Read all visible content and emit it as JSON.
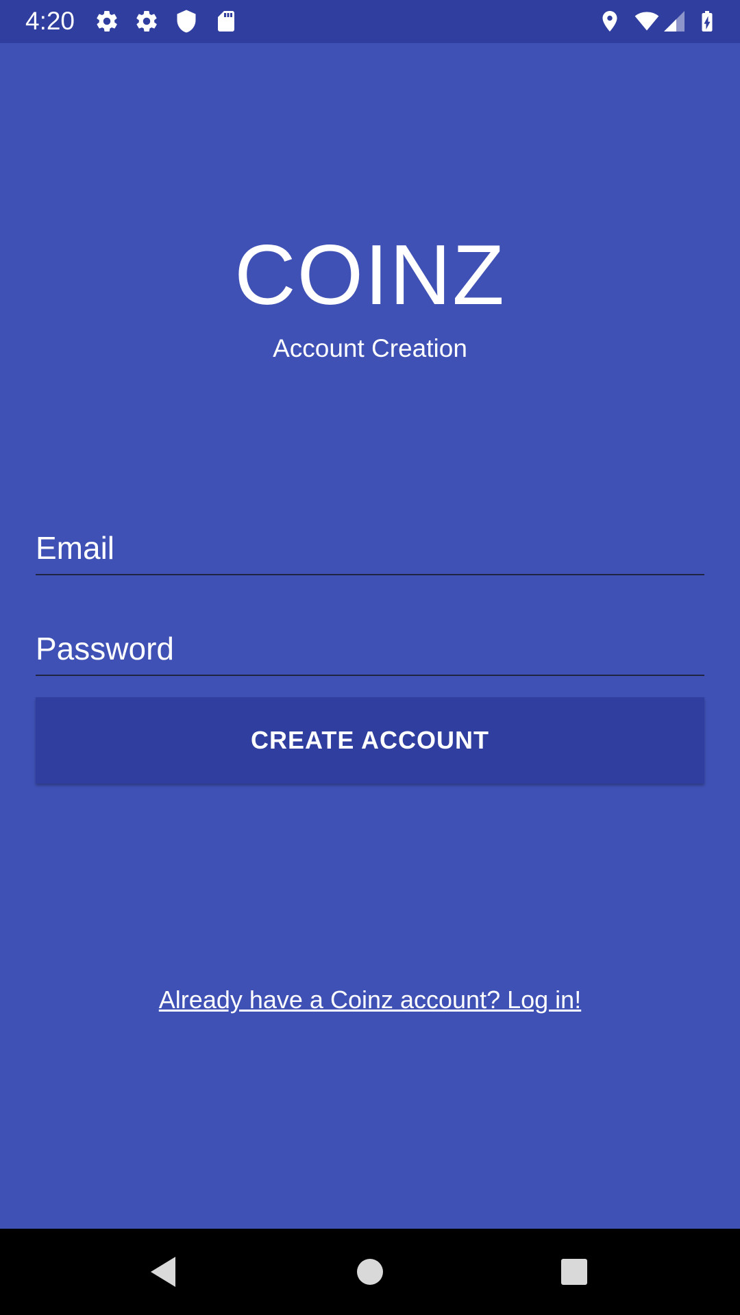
{
  "status_bar": {
    "time": "4:20",
    "left_icons": [
      "settings-icon",
      "settings-icon",
      "shield-icon",
      "sd-card-icon"
    ],
    "right_icons": [
      "location-icon",
      "wifi-icon",
      "signal-icon",
      "battery-charging-icon"
    ]
  },
  "header": {
    "app_title": "COINZ",
    "subtitle": "Account Creation"
  },
  "form": {
    "email_placeholder": "Email",
    "password_placeholder": "Password",
    "create_button_label": "CREATE ACCOUNT"
  },
  "footer": {
    "login_link": "Already have a Coinz account? Log in!"
  },
  "navigation": {
    "buttons": [
      "back-icon",
      "home-icon",
      "recents-icon"
    ]
  },
  "colors": {
    "background": "#3F51B5",
    "status_bar": "#303F9F",
    "button": "#303F9F",
    "text": "#FFFFFF",
    "nav_bar": "#000000"
  }
}
